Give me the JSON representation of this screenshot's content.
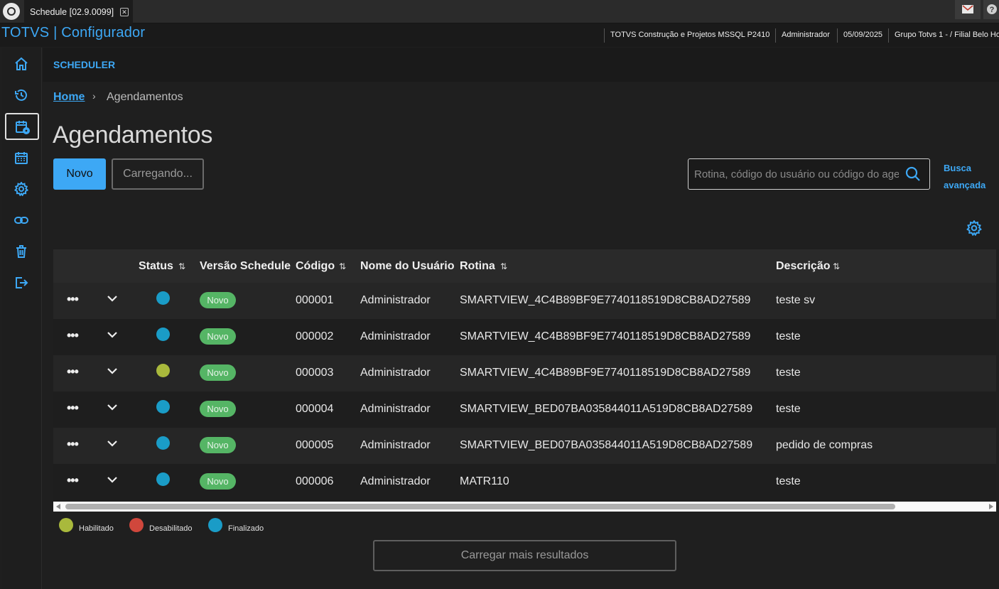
{
  "tab": {
    "title": "Schedule [02.9.0099]",
    "close_glyph": "✕"
  },
  "header": {
    "brand": "TOTVS | Configurador",
    "environment": "TOTVS Construção e Projetos MSSQL P2410",
    "user": "Administrador",
    "date": "05/09/2025",
    "branch": "Grupo Totvs 1 - / Filial Belo Ho"
  },
  "sidebar": {
    "items": [
      {
        "icon": "home-icon",
        "active": false
      },
      {
        "icon": "history-icon",
        "active": false
      },
      {
        "icon": "calendar-gear-icon",
        "active": true
      },
      {
        "icon": "calendar-icon",
        "active": false
      },
      {
        "icon": "gear-icon",
        "active": false
      },
      {
        "icon": "link-icon",
        "active": false
      },
      {
        "icon": "trash-icon",
        "active": false
      },
      {
        "icon": "logout-icon",
        "active": false
      }
    ]
  },
  "page": {
    "section": "SCHEDULER",
    "breadcrumb_home": "Home",
    "breadcrumb_current": "Agendamentos",
    "title": "Agendamentos",
    "new_button": "Novo",
    "loading_button": "Carregando...",
    "search_placeholder": "Rotina, código do usuário ou código do agendamento",
    "advanced_search_line1": "Busca",
    "advanced_search_line2": "avançada",
    "load_more": "Carregar mais resultados"
  },
  "table": {
    "columns": [
      "Status",
      "Versão Schedule",
      "Código",
      "Nome do Usuário",
      "Rotina",
      "Descrição"
    ],
    "rows": [
      {
        "status_color": "#1a9cc7",
        "version": "Novo",
        "code": "000001",
        "user": "Administrador",
        "routine": "SMARTVIEW_4C4B89BF9E7740118519D8CB8AD27589",
        "description": "teste sv"
      },
      {
        "status_color": "#1a9cc7",
        "version": "Novo",
        "code": "000002",
        "user": "Administrador",
        "routine": "SMARTVIEW_4C4B89BF9E7740118519D8CB8AD27589",
        "description": "teste"
      },
      {
        "status_color": "#a9b93c",
        "version": "Novo",
        "code": "000003",
        "user": "Administrador",
        "routine": "SMARTVIEW_4C4B89BF9E7740118519D8CB8AD27589",
        "description": "teste"
      },
      {
        "status_color": "#1a9cc7",
        "version": "Novo",
        "code": "000004",
        "user": "Administrador",
        "routine": "SMARTVIEW_BED07BA035844011A519D8CB8AD27589",
        "description": "teste"
      },
      {
        "status_color": "#1a9cc7",
        "version": "Novo",
        "code": "000005",
        "user": "Administrador",
        "routine": "SMARTVIEW_BED07BA035844011A519D8CB8AD27589",
        "description": "pedido de compras"
      },
      {
        "status_color": "#1a9cc7",
        "version": "Novo",
        "code": "000006",
        "user": "Administrador",
        "routine": "MATR110",
        "description": "teste"
      }
    ]
  },
  "legend": [
    {
      "label": "Habilitado",
      "color": "#a9b93c"
    },
    {
      "label": "Desabilitado",
      "color": "#d0473c"
    },
    {
      "label": "Finalizado",
      "color": "#1a9cc7"
    }
  ],
  "colors": {
    "accent": "#3da8f5",
    "badge": "#55b565"
  }
}
